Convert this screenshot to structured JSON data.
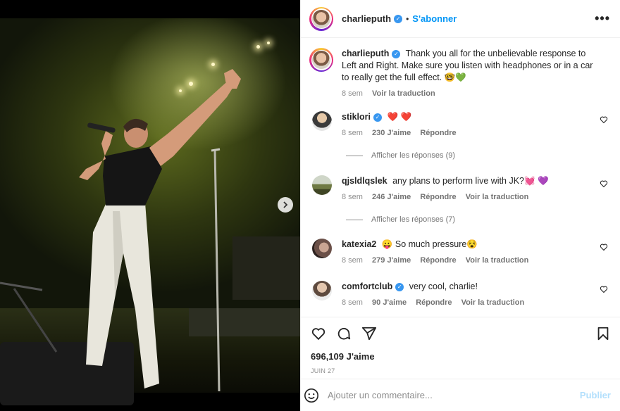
{
  "post": {
    "author": "charlieputh",
    "follow_label": "S'abonner",
    "separator": "•",
    "more_label": "•••",
    "caption": "Thank you all for the unbelievable response to Left and Right. Make sure you listen with headphones or in a car to really get the full effect. 🤓💚",
    "caption_age": "8 sem",
    "caption_translate": "Voir la traduction"
  },
  "comments": [
    {
      "user": "stiklori",
      "verified": true,
      "text": "❤️ ❤️",
      "age": "8 sem",
      "likes": "230 J'aime",
      "reply": "Répondre",
      "translate": "",
      "replies": "Afficher les réponses (9)"
    },
    {
      "user": "qjsldlqslek",
      "verified": false,
      "text": "any plans to perform live with JK?💓 💜",
      "age": "8 sem",
      "likes": "246 J'aime",
      "reply": "Répondre",
      "translate": "Voir la traduction",
      "replies": "Afficher les réponses (7)"
    },
    {
      "user": "katexia2",
      "verified": false,
      "text": "😛 So much pressure😵",
      "age": "8 sem",
      "likes": "279 J'aime",
      "reply": "Répondre",
      "translate": "Voir la traduction",
      "replies": ""
    },
    {
      "user": "comfortclub",
      "verified": true,
      "text": "very cool, charlie!",
      "age": "8 sem",
      "likes": "90 J'aime",
      "reply": "Répondre",
      "translate": "Voir la traduction",
      "replies": ""
    }
  ],
  "footer": {
    "likes": "696,109 J'aime",
    "date": "JUIN 27",
    "comment_placeholder": "Ajouter un commentaire...",
    "publish_label": "Publier"
  },
  "icons": {
    "like": "heart-icon",
    "comment": "comment-icon",
    "share": "share-icon",
    "save": "bookmark-icon",
    "emoji": "emoji-icon",
    "next": "chevron-right-icon"
  },
  "colors": {
    "accent": "#0095f6",
    "verified": "#3897f0",
    "publish_disabled": "#b2dffc"
  }
}
